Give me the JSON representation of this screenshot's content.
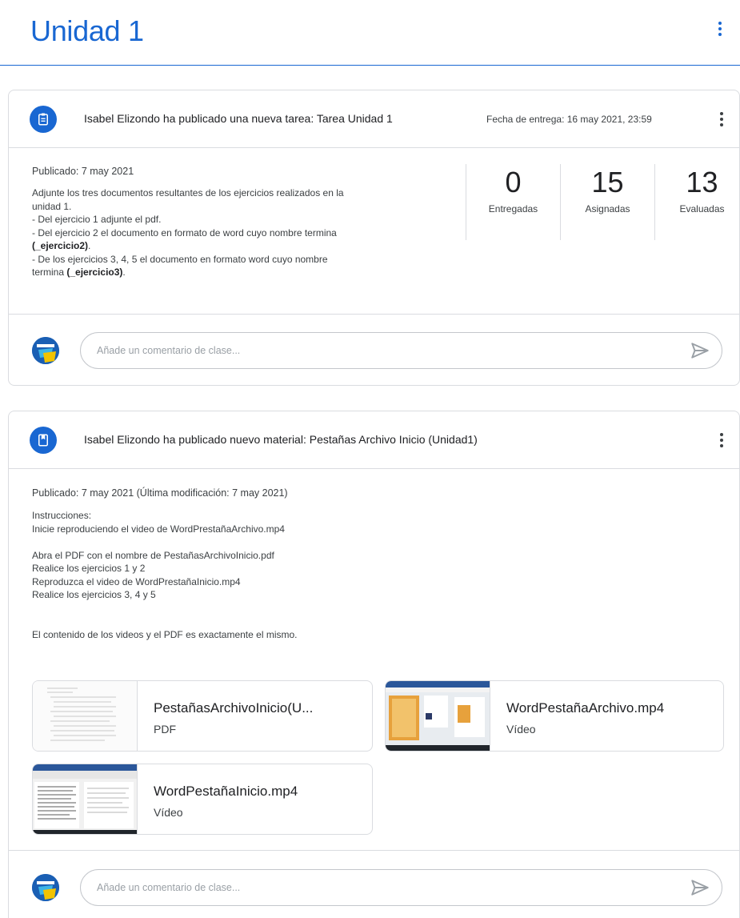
{
  "topic": {
    "title": "Unidad 1"
  },
  "assignment": {
    "header": "Isabel Elizondo ha publicado una nueva tarea: Tarea Unidad 1",
    "due": "Fecha de entrega: 16 may 2021, 23:59",
    "published": "Publicado: 7 may 2021",
    "description": [
      "Adjunte los tres documentos resultantes de los ejercicios realizados en la",
      "unidad 1.",
      "- Del ejercicio 1 adjunte el pdf.",
      "- Del ejercicio 2 el documento en formato de word cuyo nombre termina"
    ],
    "desc_line5_bold": "(_ejercicio2)",
    "desc_line5_tail": ".",
    "desc_line6": "- De los ejercicios 3, 4, 5 el documento en formato word cuyo nombre",
    "desc_line7_lead": "termina ",
    "desc_line7_bold": "(_ejercicio3)",
    "desc_line7_tail": ".",
    "stats": [
      {
        "value": "0",
        "label": "Entregadas"
      },
      {
        "value": "15",
        "label": "Asignadas"
      },
      {
        "value": "13",
        "label": "Evaluadas"
      }
    ],
    "comment_placeholder": "Añade un comentario de clase..."
  },
  "material": {
    "header": "Isabel Elizondo ha publicado nuevo material: Pestañas Archivo Inicio (Unidad1)",
    "published": "Publicado: 7 may 2021 (Última modificación: 7 may 2021)",
    "lines": [
      "Instrucciones:",
      "Inicie reproduciendo el video de WordPrestañaArchivo.mp4",
      "",
      "Abra el PDF con el nombre de PestañasArchivoInicio.pdf",
      "Realice los ejercicios 1 y 2",
      "Reproduzca el video de WordPrestañaInicio.mp4",
      "Realice los ejercicios 3, 4 y 5",
      "",
      "",
      "El contenido de los videos y el PDF es exactamente el mismo."
    ],
    "attachments": [
      {
        "name": "PestañasArchivoInicio(U...",
        "type": "PDF"
      },
      {
        "name": "WordPestañaArchivo.mp4",
        "type": "Vídeo"
      },
      {
        "name": "WordPestañaInicio.mp4",
        "type": "Vídeo"
      }
    ],
    "comment_placeholder": "Añade un comentario de clase..."
  },
  "colors": {
    "accent": "#1967d2",
    "border": "#dadce0",
    "text": "#202124"
  }
}
